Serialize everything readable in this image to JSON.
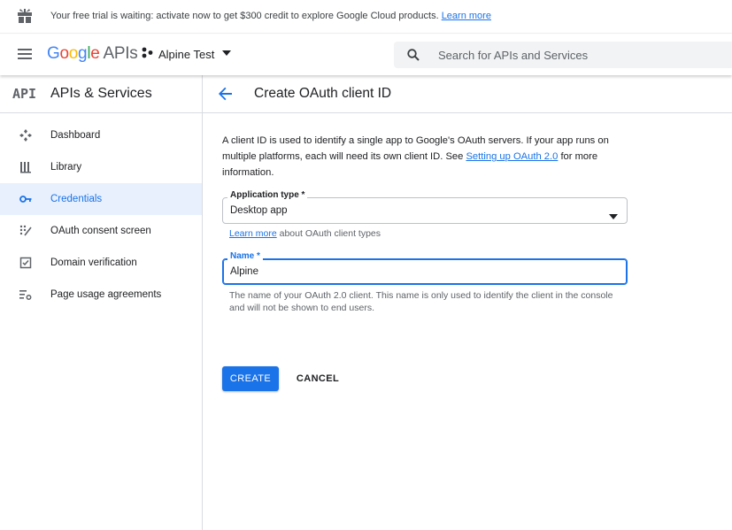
{
  "banner": {
    "message": "Your free trial is waiting: activate now to get $300 credit to explore Google Cloud products.",
    "link": "Learn more"
  },
  "header": {
    "logo_letters": [
      "G",
      "o",
      "o",
      "g",
      "l",
      "e"
    ],
    "logo_suffix": "APIs",
    "project_name": "Alpine Test",
    "search_placeholder": "Search for APIs and Services"
  },
  "sidebar": {
    "title": "APIs & Services",
    "items": [
      {
        "label": "Dashboard",
        "icon": "dashboard-icon"
      },
      {
        "label": "Library",
        "icon": "library-icon"
      },
      {
        "label": "Credentials",
        "icon": "key-icon",
        "active": true
      },
      {
        "label": "OAuth consent screen",
        "icon": "consent-icon"
      },
      {
        "label": "Domain verification",
        "icon": "checkbox-icon"
      },
      {
        "label": "Page usage agreements",
        "icon": "settings-list-icon"
      }
    ]
  },
  "main": {
    "title": "Create OAuth client ID",
    "intro_part1": "A client ID is used to identify a single app to Google's OAuth servers. If your app runs on multiple platforms, each will need its own client ID. See ",
    "intro_link": "Setting up OAuth 2.0",
    "intro_part2": " for more information.",
    "app_type": {
      "label": "Application type *",
      "value": "Desktop app",
      "hint_link": "Learn more",
      "hint_text": " about OAuth client types"
    },
    "name_field": {
      "label": "Name *",
      "value": "Alpine",
      "hint": "The name of your OAuth 2.0 client. This name is only used to identify the client in the console and will not be shown to end users."
    },
    "create_label": "CREATE",
    "cancel_label": "CANCEL"
  },
  "colors": {
    "accent": "#1a73e8",
    "active_bg": "#e8f0fe",
    "text": "#202124",
    "muted": "#5f6368"
  }
}
